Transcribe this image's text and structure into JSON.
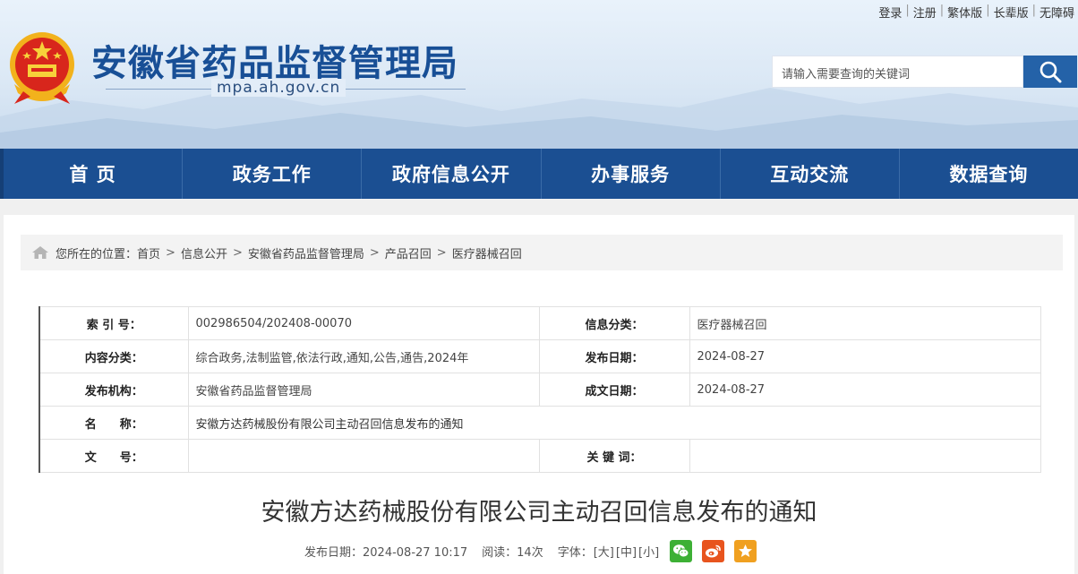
{
  "top_links": [
    "登录",
    "注册",
    "繁体版",
    "长辈版",
    "无障碍"
  ],
  "site": {
    "title": "安徽省药品监督管理局",
    "domain": "mpa.ah.gov.cn"
  },
  "search": {
    "placeholder": "请输入需要查询的关键词"
  },
  "nav": [
    "首 页",
    "政务工作",
    "政府信息公开",
    "办事服务",
    "互动交流",
    "数据查询"
  ],
  "breadcrumb": {
    "prefix": "您所在的位置：",
    "items": [
      "首页",
      "信息公开",
      "安徽省药品监督管理局",
      "产品召回",
      "医疗器械召回"
    ],
    "separator": ">"
  },
  "info": {
    "index_label": "索 引 号：",
    "index_value": "002986504/202408-00070",
    "category_label": "信息分类：",
    "category_value": "医疗器械召回",
    "content_label": "内容分类：",
    "content_value": "综合政务,法制监管,依法行政,通知,公告,通告,2024年",
    "pubdate_label": "发布日期：",
    "pubdate_value": "2024-08-27",
    "org_label": "发布机构：",
    "org_value": "安徽省药品监督管理局",
    "docdate_label": "成文日期：",
    "docdate_value": "2024-08-27",
    "name_label": "名　　称：",
    "name_value": "安徽方达药械股份有限公司主动召回信息发布的通知",
    "docno_label": "文　　号：",
    "docno_value": "",
    "keyword_label": "关 键 词：",
    "keyword_value": ""
  },
  "article": {
    "title": "安徽方达药械股份有限公司主动召回信息发布的通知",
    "date_text": "发布日期：2024-08-27 10:17",
    "read_text": "阅读：14次",
    "font_label": "字体：",
    "font_sizes": [
      "[大]",
      "[中]",
      "[小]"
    ]
  },
  "colors": {
    "nav_bg": "#1b4f92",
    "title_blue": "#184f96",
    "wechat": "#3db035",
    "weibo": "#e8541e",
    "favorite": "#f0a020"
  },
  "icons": [
    "national-emblem-icon",
    "search-icon",
    "home-icon",
    "wechat-icon",
    "weibo-icon",
    "star-icon"
  ]
}
